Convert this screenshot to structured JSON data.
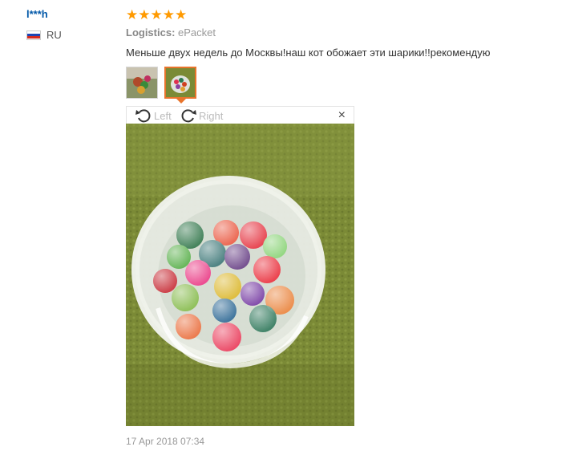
{
  "review": {
    "user_name": "l***h",
    "country_code": "RU",
    "stars": "★★★★★",
    "logistics_label": "Logistics:",
    "logistics_value": "ePacket",
    "text": "Меньше двух недель до Москвы!наш кот обожает эти шарики!!рекомендую",
    "date": "17 Apr 2018 07:34"
  },
  "viewer": {
    "rotate_left_label": "Left",
    "rotate_right_label": "Right",
    "close_glyph": "×"
  },
  "colors": {
    "user_link": "#0057a8",
    "star": "#ff9a00",
    "thumb_active_border": "#e8742c",
    "muted_text": "#999999",
    "towel_green": "#7a8a35"
  }
}
